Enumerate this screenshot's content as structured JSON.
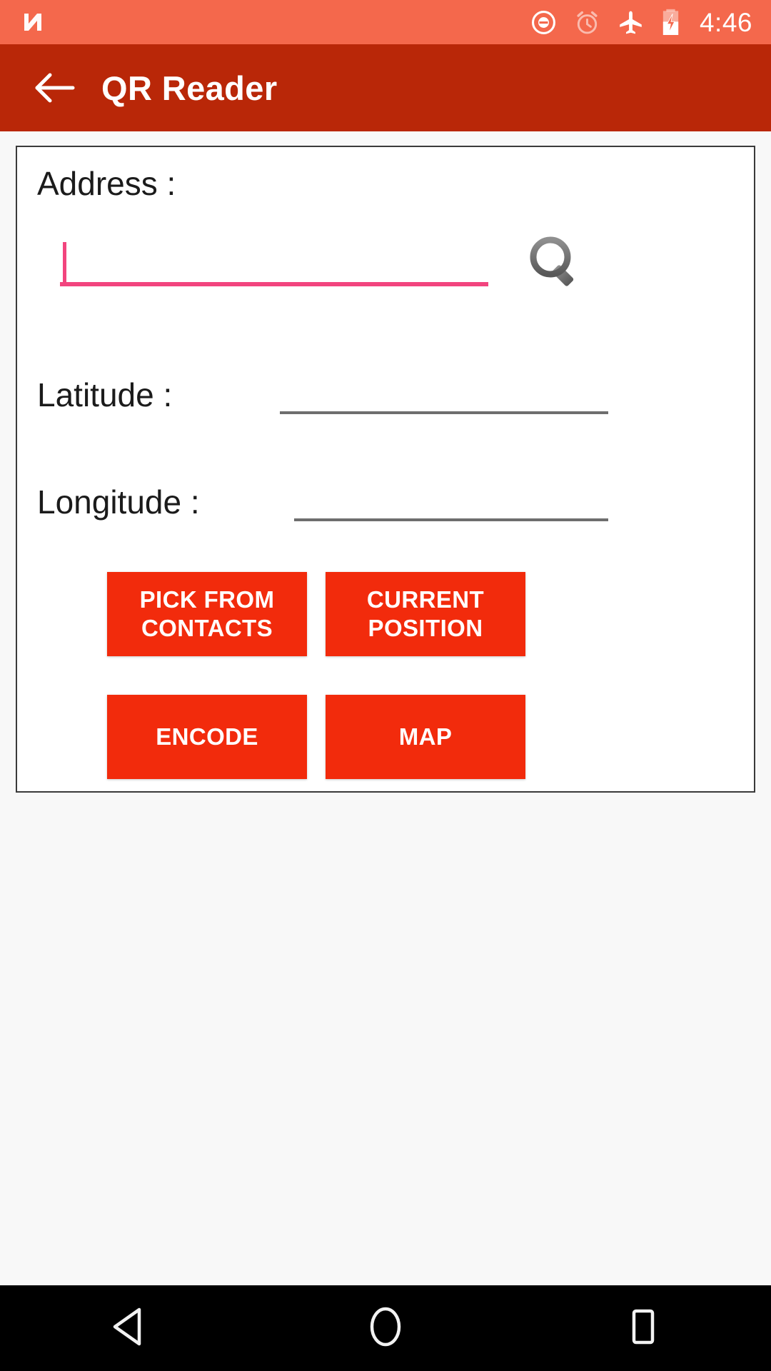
{
  "status_bar": {
    "time": "4:46",
    "icons": [
      "nextbit-logo",
      "do-not-disturb-icon",
      "alarm-icon",
      "airplane-mode-icon",
      "battery-charging-icon"
    ],
    "background_color": "#F4684C"
  },
  "app_bar": {
    "back_label": "back-arrow",
    "title": "QR Reader",
    "background_color": "#B92708",
    "text_color": "#FFFFFF"
  },
  "form": {
    "address": {
      "label": "Address :",
      "value": "",
      "placeholder": "",
      "underline_color": "#F2447E",
      "caret_color": "#F2447E",
      "search_icon": "magnifier-icon"
    },
    "latitude": {
      "label": "Latitude :",
      "value": "",
      "placeholder": "",
      "underline_color": "#6E6E6E"
    },
    "longitude": {
      "label": "Longitude :",
      "value": "",
      "placeholder": "",
      "underline_color": "#6E6E6E"
    }
  },
  "buttons": {
    "color": "#F22B0C",
    "text_color": "#FFFFFF",
    "items": [
      {
        "id": "pick-from-contacts",
        "label": "PICK FROM\nCONTACTS"
      },
      {
        "id": "current-position",
        "label": "CURRENT\nPOSITION"
      },
      {
        "id": "encode",
        "label": "ENCODE"
      },
      {
        "id": "map",
        "label": "MAP"
      }
    ]
  },
  "nav_bar": {
    "background_color": "#000000",
    "items": [
      {
        "id": "back",
        "icon": "triangle-back-icon"
      },
      {
        "id": "home",
        "icon": "circle-home-icon"
      },
      {
        "id": "recents",
        "icon": "square-recents-icon"
      }
    ]
  }
}
